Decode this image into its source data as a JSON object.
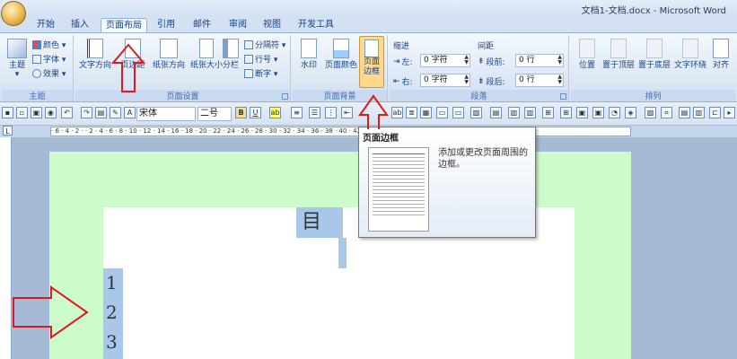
{
  "window": {
    "title": "文档1-文档.docx - Microsoft Word"
  },
  "tabs": [
    "开始",
    "插入",
    "页面布局",
    "引用",
    "邮件",
    "审阅",
    "视图",
    "开发工具"
  ],
  "active_tab": "页面布局",
  "ribbon": {
    "theme": {
      "label": "主题",
      "items": {
        "colors": "颜色 ▾",
        "fonts": "字体 ▾",
        "effects": "效果 ▾"
      },
      "group": "主题"
    },
    "page_setup": {
      "buttons": [
        "文字方向",
        "页边距",
        "纸张方向",
        "纸张大小",
        "分栏"
      ],
      "items": {
        "breaks": "分隔符 ▾",
        "line_numbers": "行号 ▾",
        "hyphenation": "断字 ▾"
      },
      "group": "页面设置"
    },
    "page_background": {
      "watermark": "水印",
      "page_color": "页面颜色",
      "page_borders": "页面边框",
      "group": "页面背景"
    },
    "indent": {
      "header": "缩进",
      "left_label": "左:",
      "left_value": "0 字符",
      "right_label": "右:",
      "right_value": "0 字符"
    },
    "spacing": {
      "header": "间距",
      "before_label": "段前:",
      "before_value": "0 行",
      "after_label": "段后:",
      "after_value": "0 行"
    },
    "paragraph_group": "段落",
    "arrange": {
      "buttons": [
        "位置",
        "置于顶层",
        "置于底层",
        "文字环绕",
        "对齐"
      ],
      "group": "排列"
    }
  },
  "toolbar": {
    "font_name": "宋体",
    "font_size": "二号",
    "bold": "B",
    "underline": "U"
  },
  "ruler": {
    "marks": "· 6 · 4 · 2 ·   · 2 · 4 · 6 · 8 · 10 · 12 · 14 · 16 · 18 · 20 · 22 · 24 · 26 · 28 · 30 · 32 · 34 · 36 · 38 · 40 · 42 · 44 · 46 · 48 ·"
  },
  "document": {
    "title_char": "目",
    "numbers": [
      "1",
      "2",
      "3"
    ]
  },
  "tooltip": {
    "title": "页面边框",
    "description": "添加或更改页面周围的边框。"
  },
  "colors": {
    "page_background": "#ccfbcc",
    "selection": "#a9c7ea",
    "annotation": "#e0191b"
  }
}
